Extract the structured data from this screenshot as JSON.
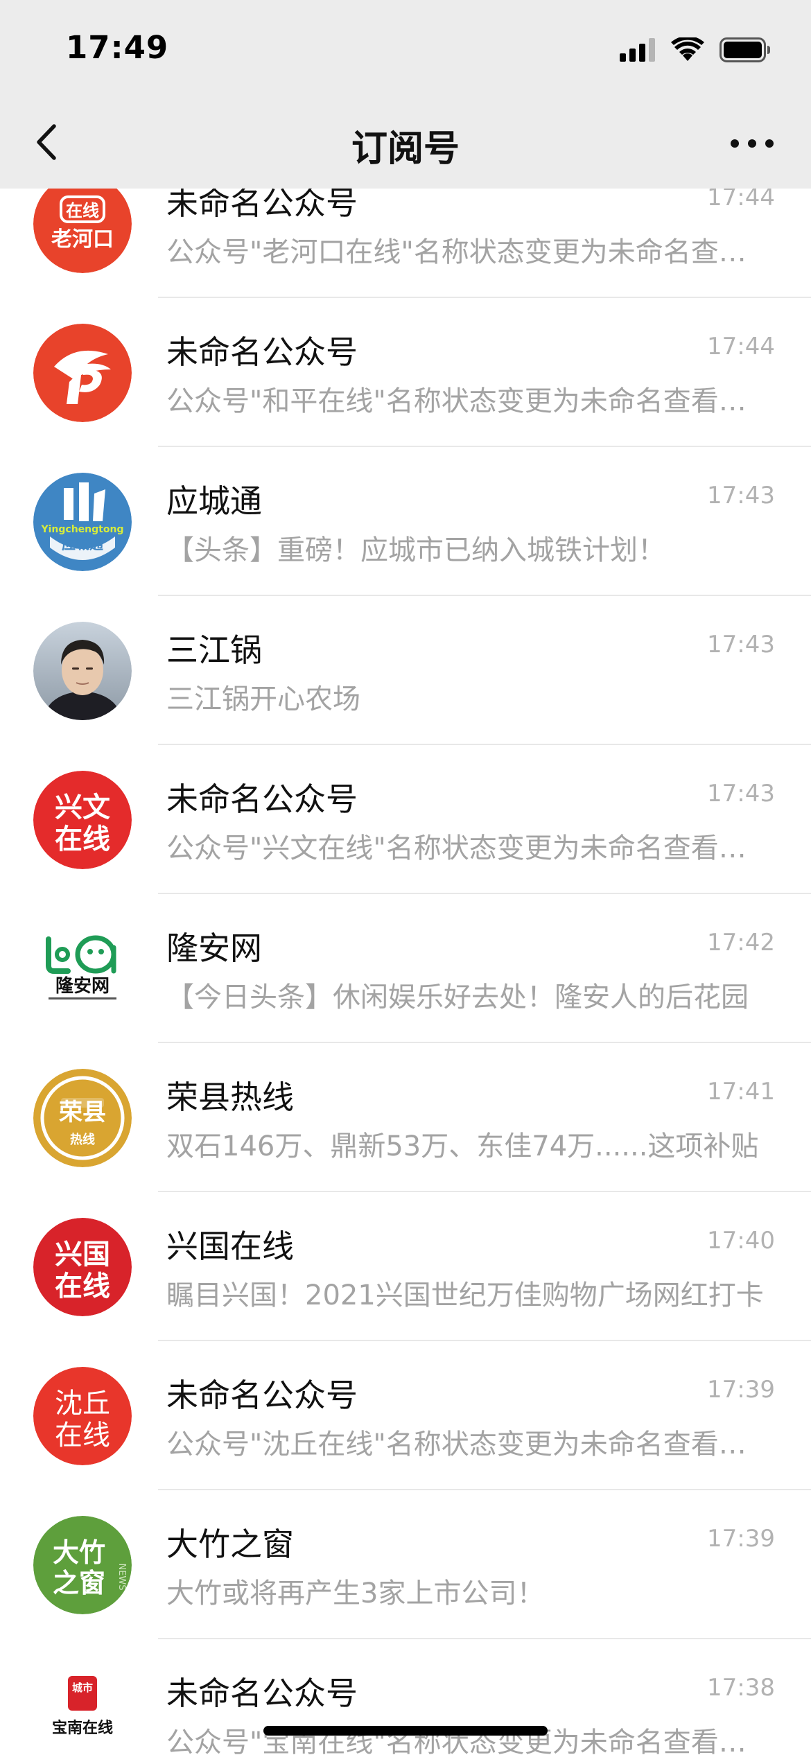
{
  "status_bar": {
    "time": "17:49",
    "icons": [
      "cellular-signal-icon",
      "wifi-icon",
      "battery-icon"
    ]
  },
  "nav": {
    "title": "订阅号",
    "back_icon": "chevron-left-icon",
    "more_icon": "more-dots-icon"
  },
  "colors": {
    "header_bg": "#ececec",
    "name_text": "#111111",
    "preview_text": "#a3a3a3",
    "time_text": "#b2b2b2",
    "separator": "#e8e8e8"
  },
  "items": [
    {
      "name": "未命名公众号",
      "time": "17:44",
      "preview": "公众号\"老河口在线\"名称状态变更为未命名查看详情",
      "avatar": {
        "lines": [
          "在线",
          "老河口"
        ],
        "bg": "#e8432b"
      }
    },
    {
      "name": "未命名公众号",
      "time": "17:44",
      "preview": "公众号\"和平在线\"名称状态变更为未命名查看详情",
      "avatar": {
        "bg": "#e8432b"
      }
    },
    {
      "name": "应城通",
      "time": "17:43",
      "preview": "【头条】重磅！应城市已纳入城铁计划！",
      "avatar": {
        "lines": [
          "Yingchengtong",
          "应城通"
        ],
        "bg": "#3f86c4"
      }
    },
    {
      "name": "三江锅",
      "time": "17:43",
      "preview": "三江锅开心农场",
      "avatar": {
        "bg": "#a7b4c0"
      }
    },
    {
      "name": "未命名公众号",
      "time": "17:43",
      "preview": "公众号\"兴文在线\"名称状态变更为未命名查看详情",
      "avatar": {
        "lines": [
          "兴文",
          "在线"
        ],
        "bg": "#e42b2b"
      }
    },
    {
      "name": "隆安网",
      "time": "17:42",
      "preview": "【今日头条】休闲娱乐好去处！隆安人的后花园",
      "avatar": {
        "lines": [
          "隆安网"
        ],
        "bg": "#ffffff"
      }
    },
    {
      "name": "荣县热线",
      "time": "17:41",
      "preview": "双石146万、鼎新53万、东佳74万......这项补贴",
      "avatar": {
        "lines": [
          "荣县",
          "热线"
        ],
        "bg": "#d9a531"
      }
    },
    {
      "name": "兴国在线",
      "time": "17:40",
      "preview": "瞩目兴国！2021兴国世纪万佳购物广场网红打卡",
      "avatar": {
        "lines": [
          "兴国",
          "在线"
        ],
        "bg": "#d8232a"
      }
    },
    {
      "name": "未命名公众号",
      "time": "17:39",
      "preview": "公众号\"沈丘在线\"名称状态变更为未命名查看详情",
      "avatar": {
        "lines": [
          "沈丘",
          "在线"
        ],
        "bg": "#e8362b"
      }
    },
    {
      "name": "大竹之窗",
      "time": "17:39",
      "preview": "大竹或将再产生3家上市公司！",
      "avatar": {
        "lines": [
          "大竹",
          "之窗",
          "NEWS"
        ],
        "bg": "#5e9f3c"
      }
    },
    {
      "name": "未命名公众号",
      "time": "17:38",
      "preview": "公众号\"宝南在线\"名称状态变更为未命名查看详情",
      "avatar": {
        "lines": [
          "城市",
          "宝南在线"
        ],
        "bg": "#ffffff"
      }
    }
  ]
}
